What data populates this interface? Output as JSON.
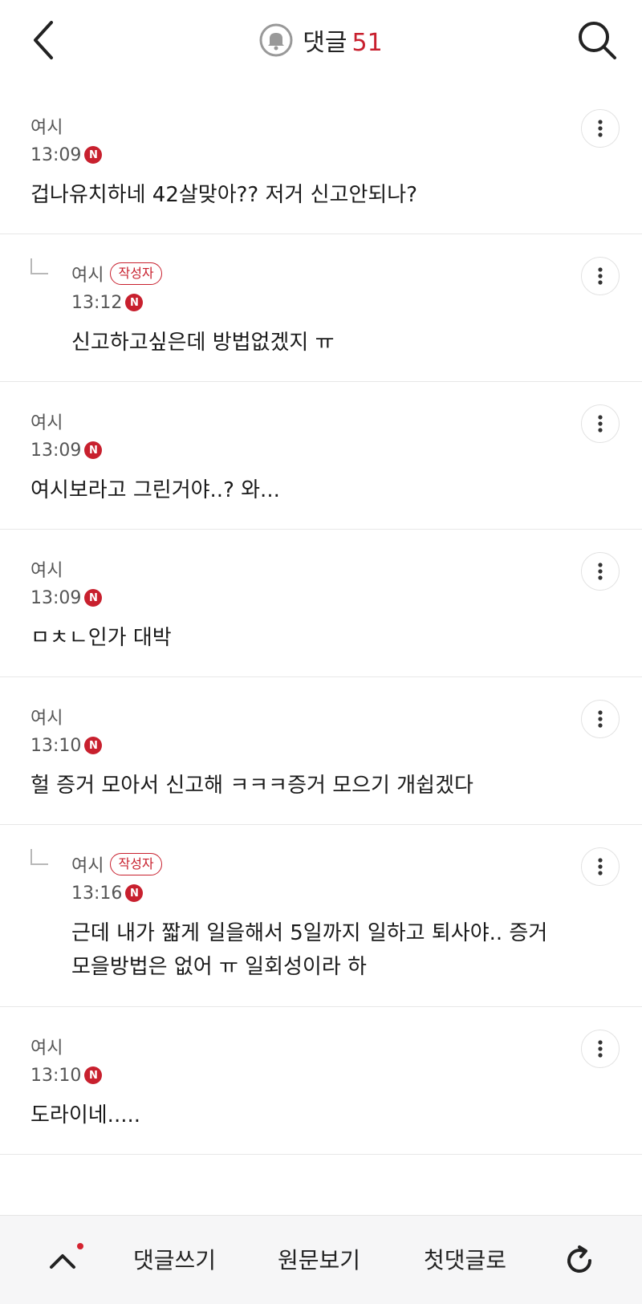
{
  "header": {
    "title": "댓글",
    "count": "51"
  },
  "comments": [
    {
      "nick": "여시",
      "time": "13:09",
      "badge": "N",
      "text": "겁나유치하네 42살맞아?? 저거 신고안되나?"
    },
    {
      "nick": "여시",
      "author": "작성자",
      "time": "13:12",
      "badge": "N",
      "text": "신고하고싶은데 방법없겠지 ㅠ"
    },
    {
      "nick": "여시",
      "time": "13:09",
      "badge": "N",
      "text": "여시보라고 그린거야..? 와..."
    },
    {
      "nick": "여시",
      "time": "13:09",
      "badge": "N",
      "text": "ㅁㅊㄴ인가 대박"
    },
    {
      "nick": "여시",
      "time": "13:10",
      "badge": "N",
      "text": "헐 증거 모아서 신고해 ㅋㅋㅋ증거 모으기 개쉽겠다"
    },
    {
      "nick": "여시",
      "author": "작성자",
      "time": "13:16",
      "badge": "N",
      "text": "근데 내가 짧게 일을해서 5일까지 일하고 퇴사야.. 증거 모을방법은 없어 ㅠ 일회성이라 하"
    },
    {
      "nick": "여시",
      "time": "13:10",
      "badge": "N",
      "text": "도라이네....."
    }
  ],
  "bottom": {
    "write": "댓글쓰기",
    "original": "원문보기",
    "first": "첫댓글로"
  },
  "colors": {
    "accent": "#c8202e",
    "bar_bg": "#f6f6f7"
  }
}
